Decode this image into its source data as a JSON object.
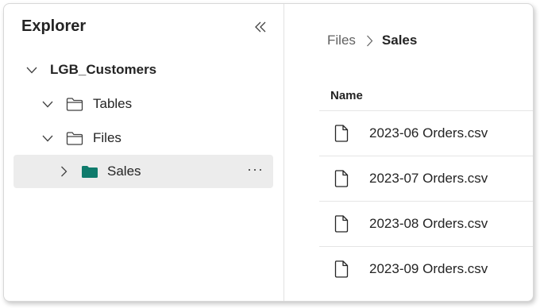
{
  "explorer": {
    "title": "Explorer",
    "collapse_icon": "double-chevron-left-icon",
    "tree": {
      "root": {
        "label": "LGB_Customers",
        "expanded": true
      },
      "tables": {
        "label": "Tables",
        "expanded": true,
        "icon": "folder-outline-icon"
      },
      "files": {
        "label": "Files",
        "expanded": true,
        "icon": "folder-outline-icon"
      },
      "sales": {
        "label": "Sales",
        "expanded": false,
        "selected": true,
        "icon": "folder-filled-icon",
        "more": "···"
      }
    }
  },
  "content": {
    "breadcrumb": {
      "parent": "Files",
      "current": "Sales"
    },
    "column_header": "Name",
    "files": [
      {
        "name": "2023-06 Orders.csv",
        "icon": "file-icon"
      },
      {
        "name": "2023-07 Orders.csv",
        "icon": "file-icon"
      },
      {
        "name": "2023-08 Orders.csv",
        "icon": "file-icon"
      },
      {
        "name": "2023-09 Orders.csv",
        "icon": "file-icon"
      }
    ]
  },
  "colors": {
    "folder_filled": "#0f7b6c",
    "selected_row": "#ececec",
    "text": "#242424",
    "muted_text": "#616161"
  }
}
